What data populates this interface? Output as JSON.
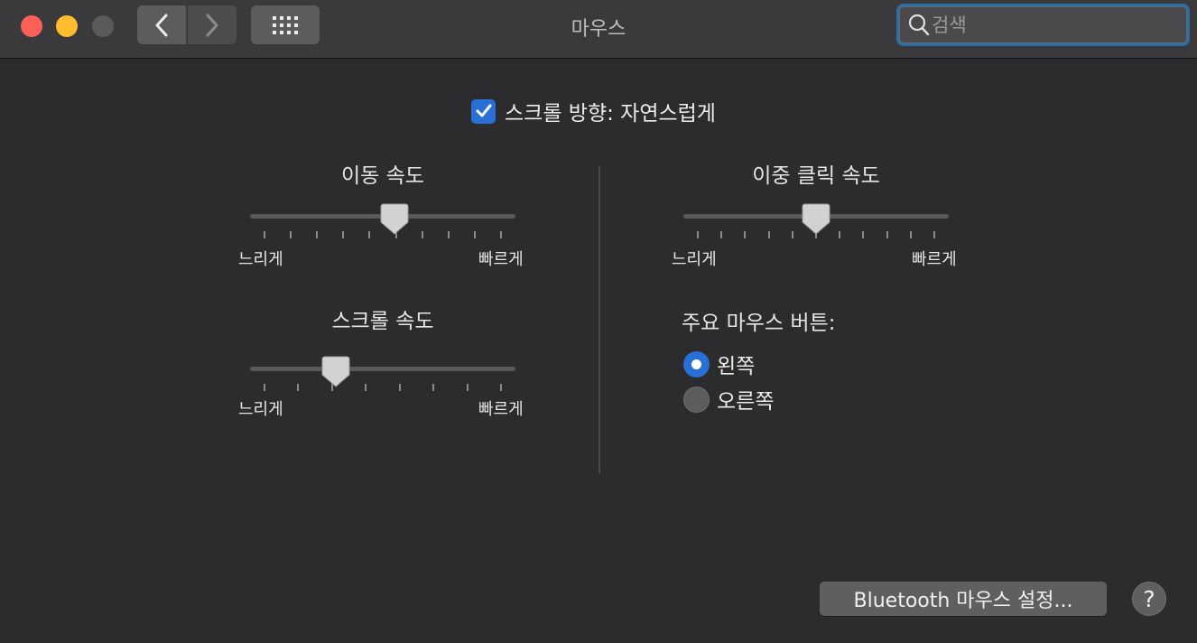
{
  "window": {
    "title": "마우스"
  },
  "search": {
    "placeholder": "검색",
    "value": ""
  },
  "scroll_direction": {
    "label": "스크롤 방향: 자연스럽게",
    "checked": true
  },
  "tracking_speed": {
    "title": "이동 속도",
    "min_label": "느리게",
    "max_label": "빠르게",
    "value": 0.55,
    "ticks": 10
  },
  "scroll_speed": {
    "title": "스크롤 속도",
    "min_label": "느리게",
    "max_label": "빠르게",
    "value": 0.3,
    "ticks": 8
  },
  "double_click_speed": {
    "title": "이중 클릭 속도",
    "min_label": "느리게",
    "max_label": "빠르게",
    "value": 0.5,
    "ticks": 11
  },
  "primary_button": {
    "title": "주요 마우스 버튼:",
    "options": [
      {
        "label": "왼쪽",
        "selected": true
      },
      {
        "label": "오른쪽",
        "selected": false
      }
    ]
  },
  "bluetooth_button": {
    "label": "Bluetooth 마우스 설정..."
  },
  "help_button": {
    "label": "?"
  },
  "colors": {
    "accent": "#2a6fd6",
    "close": "#fe5f57",
    "minimize": "#febc2e",
    "zoom_disabled": "#5a5a5c"
  },
  "icons": {
    "back": "chevron-left-icon",
    "forward": "chevron-right-icon",
    "grid": "grid-icon",
    "search": "search-icon",
    "checkbox": "checkmark-icon"
  }
}
